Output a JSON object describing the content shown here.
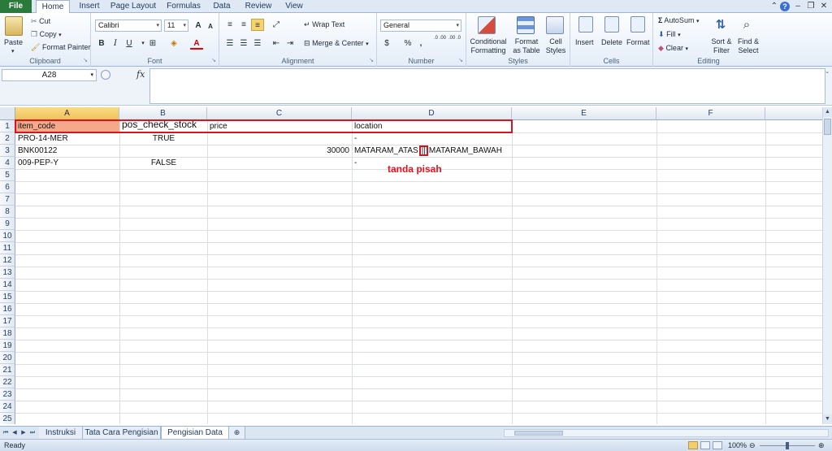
{
  "ribbon_tabs": [
    "File",
    "Home",
    "Insert",
    "Page Layout",
    "Formulas",
    "Data",
    "Review",
    "View"
  ],
  "active_tab": "Home",
  "clipboard": {
    "paste": "Paste",
    "cut": "Cut",
    "copy": "Copy",
    "format_painter": "Format Painter",
    "label": "Clipboard"
  },
  "font": {
    "name": "Calibri",
    "size": "11",
    "bold": "B",
    "italic": "I",
    "underline": "U",
    "grow": "A",
    "shrink": "A",
    "label": "Font"
  },
  "alignment": {
    "wrap_text": "Wrap Text",
    "merge_center": "Merge & Center",
    "label": "Alignment"
  },
  "number": {
    "format": "General",
    "percent": "%",
    "comma": ",",
    "inc_decimal": ".0 .00",
    "dec_decimal": ".00 .0",
    "currency": "$",
    "label": "Number"
  },
  "styles": {
    "conditional_line1": "Conditional",
    "conditional_line2": "Formatting",
    "table_line1": "Format",
    "table_line2": "as Table",
    "cell_line1": "Cell",
    "cell_line2": "Styles",
    "label": "Styles"
  },
  "cells": {
    "insert": "Insert",
    "delete": "Delete",
    "format": "Format",
    "label": "Cells"
  },
  "editing": {
    "autosum": "AutoSum",
    "fill": "Fill",
    "clear": "Clear",
    "sort_line1": "Sort &",
    "sort_line2": "Filter",
    "find_line1": "Find &",
    "find_line2": "Select",
    "label": "Editing"
  },
  "formula_bar": {
    "name_box": "A28",
    "fx": "fx",
    "formula": ""
  },
  "columns": [
    "A",
    "B",
    "C",
    "D",
    "E",
    "F"
  ],
  "rows": [
    "1",
    "2",
    "3",
    "4",
    "5",
    "6",
    "7",
    "8",
    "9",
    "10",
    "11",
    "12",
    "13",
    "14",
    "15",
    "16",
    "17",
    "18",
    "19",
    "20",
    "21",
    "22",
    "23",
    "24",
    "25"
  ],
  "cells_data": {
    "A1": "item_code",
    "B1": "pos_check_stock",
    "C1": "price",
    "D1": "location",
    "A2": "PRO-14-MER",
    "B2": "TRUE",
    "D2": "-",
    "A3": "BNK00122",
    "C3": "30000",
    "D3_left": "MATARAM_ATAS",
    "D3_sep": "||",
    "D3_right": "MATARAM_BAWAH",
    "A4": "009-PEP-Y",
    "B4": "FALSE",
    "D4": "-"
  },
  "annotation": "tanda pisah",
  "sheet_tabs": [
    "Instruksi",
    "Tata Cara Pengisian",
    "Pengisian Data"
  ],
  "active_sheet": "Pengisian Data",
  "status": {
    "ready": "Ready",
    "zoom": "100%"
  },
  "colors": {
    "file_tab": "#2a7a3b",
    "a1_fill": "#f5a98a",
    "highlight_red": "#d8141e",
    "selected_col": "#f0c25a"
  }
}
